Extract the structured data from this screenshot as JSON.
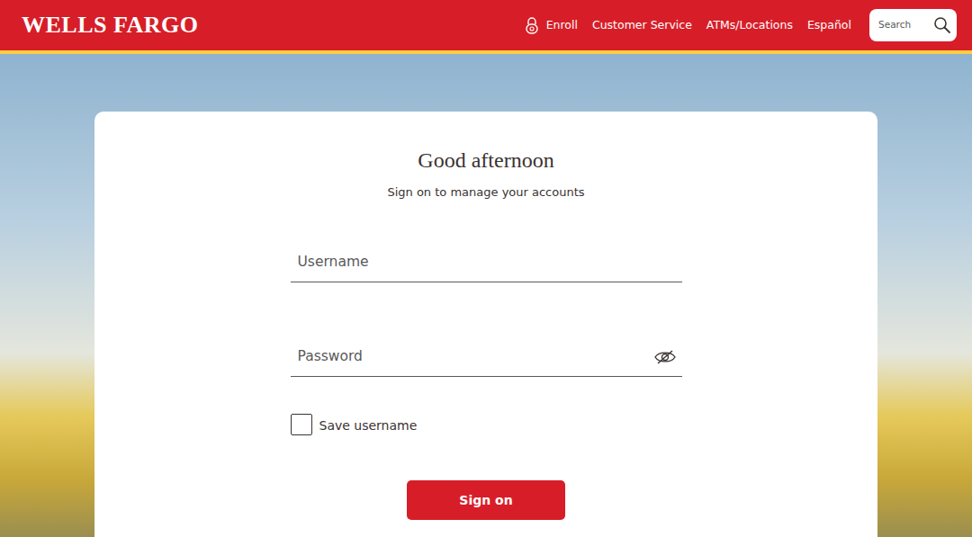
{
  "header": {
    "logo": "WELLS FARGO",
    "nav": [
      {
        "label": "Enroll",
        "kind": "icon"
      },
      {
        "label": "Customer Service",
        "kind": "text"
      },
      {
        "label": "ATMs/Locations",
        "kind": "text"
      },
      {
        "label": "Español",
        "kind": "text"
      }
    ],
    "search": {
      "placeholder": "Search"
    }
  },
  "signon": {
    "title": "Good afternoon",
    "subtitle": "Sign on to manage your accounts",
    "username": {
      "placeholder": "Username"
    },
    "password": {
      "placeholder": "Password"
    },
    "save_username": {
      "label": "Save username",
      "checked": false
    },
    "button": "Sign on"
  }
}
